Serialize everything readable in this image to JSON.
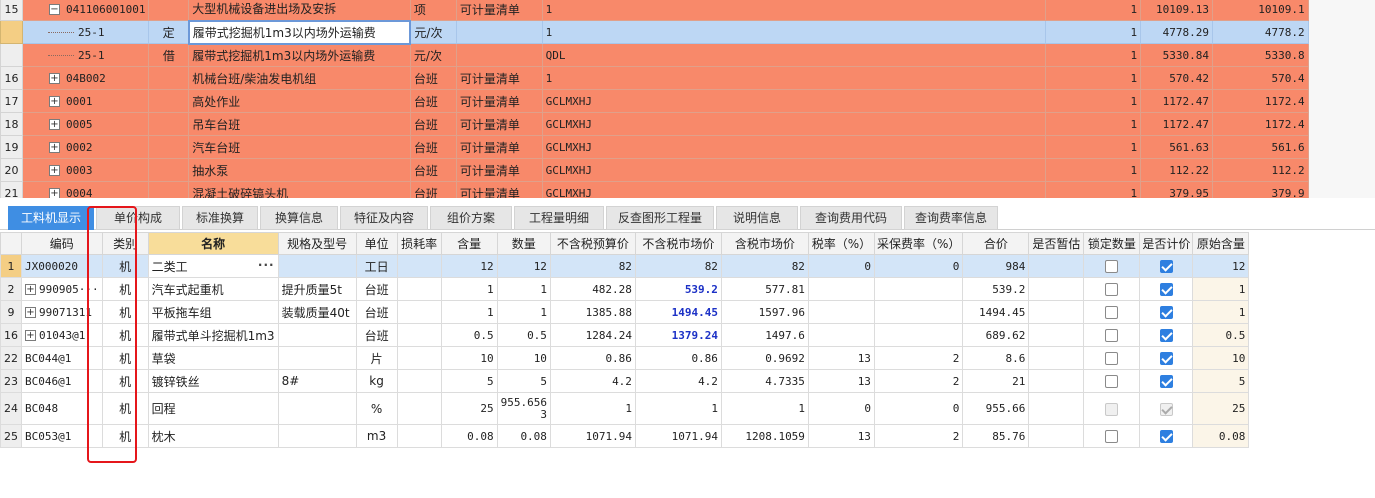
{
  "top_rows": [
    {
      "idx": "15",
      "code": "041106001001",
      "expander": "−",
      "type": "",
      "name": "大型机械设备进出场及安拆",
      "unit": "项",
      "qty_type": "可计量清单",
      "expr": "1",
      "qty": "1",
      "price": "10109.13",
      "total": "10109.1"
    },
    {
      "idx": "",
      "code": "25-1",
      "type": "定",
      "name": "履带式挖掘机1m3以内场外运输费",
      "unit": "元/次",
      "qty_type": "",
      "expr": "1",
      "qty": "1",
      "price": "4778.29",
      "total": "4778.2",
      "selected": true
    },
    {
      "idx": "",
      "code": "25-1",
      "type": "借",
      "name": "履带式挖掘机1m3以内场外运输费",
      "unit": "元/次",
      "qty_type": "",
      "expr": "QDL",
      "qty": "1",
      "price": "5330.84",
      "total": "5330.8"
    },
    {
      "idx": "16",
      "code": "04B002",
      "expander": "+",
      "type": "",
      "name": "机械台班/柴油发电机组",
      "unit": "台班",
      "qty_type": "可计量清单",
      "expr": "1",
      "qty": "1",
      "price": "570.42",
      "total": "570.4"
    },
    {
      "idx": "17",
      "code": "0001",
      "expander": "+",
      "type": "",
      "name": "高处作业",
      "unit": "台班",
      "qty_type": "可计量清单",
      "expr": "GCLMXHJ",
      "qty": "1",
      "price": "1172.47",
      "total": "1172.4"
    },
    {
      "idx": "18",
      "code": "0005",
      "expander": "+",
      "type": "",
      "name": "吊车台班",
      "unit": "台班",
      "qty_type": "可计量清单",
      "expr": "GCLMXHJ",
      "qty": "1",
      "price": "1172.47",
      "total": "1172.4"
    },
    {
      "idx": "19",
      "code": "0002",
      "expander": "+",
      "type": "",
      "name": "汽车台班",
      "unit": "台班",
      "qty_type": "可计量清单",
      "expr": "GCLMXHJ",
      "qty": "1",
      "price": "561.63",
      "total": "561.6"
    },
    {
      "idx": "20",
      "code": "0003",
      "expander": "+",
      "type": "",
      "name": "抽水泵",
      "unit": "台班",
      "qty_type": "可计量清单",
      "expr": "GCLMXHJ",
      "qty": "1",
      "price": "112.22",
      "total": "112.2"
    },
    {
      "idx": "21",
      "code": "0004",
      "expander": "+",
      "type": "",
      "name": "混凝土破碎镐头机",
      "unit": "台班",
      "qty_type": "可计量清单",
      "expr": "GCLMXHJ",
      "qty": "1",
      "price": "379.95",
      "total": "379.9"
    }
  ],
  "tabs": [
    {
      "label": "工料机显示",
      "active": true
    },
    {
      "label": "单价构成"
    },
    {
      "label": "标准换算"
    },
    {
      "label": "换算信息"
    },
    {
      "label": "特征及内容"
    },
    {
      "label": "组价方案"
    },
    {
      "label": "工程量明细"
    },
    {
      "label": "反查图形工程量"
    },
    {
      "label": "说明信息"
    },
    {
      "label": "查询费用代码"
    },
    {
      "label": "查询费率信息"
    }
  ],
  "columns": [
    "编码",
    "类别",
    "名称",
    "规格及型号",
    "单位",
    "损耗率",
    "含量",
    "数量",
    "不含税预算价",
    "不含税市场价",
    "含税市场价",
    "税率（%）",
    "采保费率（%）",
    "合价",
    "是否暂估",
    "锁定数量",
    "是否计价",
    "原始含量"
  ],
  "rows": [
    {
      "idx": "1",
      "code": "JX000020",
      "type": "机",
      "name": "二类工",
      "spec": "",
      "unit": "工日",
      "loss": "",
      "content": "12",
      "qty": "12",
      "pre_price": "82",
      "market": "82",
      "tax_market": "82",
      "tax_rate": "0",
      "fee_rate": "0",
      "total": "984",
      "lock": false,
      "price_on": true,
      "orig": "12",
      "selected": true,
      "dots": "···"
    },
    {
      "idx": "2",
      "expander": "+",
      "code": "990905···",
      "type": "机",
      "name": "汽车式起重机",
      "spec": "提升质量5t",
      "unit": "台班",
      "loss": "",
      "content": "1",
      "qty": "1",
      "pre_price": "482.28",
      "market": "539.2",
      "market_blue": true,
      "tax_market": "577.81",
      "tax_rate": "",
      "fee_rate": "",
      "total": "539.2",
      "lock": false,
      "price_on": true,
      "orig": "1"
    },
    {
      "idx": "9",
      "expander": "+",
      "code": "99071311",
      "type": "机",
      "name": "平板拖车组",
      "spec": "装载质量40t",
      "unit": "台班",
      "loss": "",
      "content": "1",
      "qty": "1",
      "pre_price": "1385.88",
      "market": "1494.45",
      "market_blue": true,
      "tax_market": "1597.96",
      "tax_rate": "",
      "fee_rate": "",
      "total": "1494.45",
      "lock": false,
      "price_on": true,
      "orig": "1"
    },
    {
      "idx": "16",
      "expander": "+",
      "code": "01043@1",
      "type": "机",
      "name": "履带式单斗挖掘机1m3",
      "spec": "",
      "unit": "台班",
      "loss": "",
      "content": "0.5",
      "qty": "0.5",
      "pre_price": "1284.24",
      "market": "1379.24",
      "market_blue": true,
      "tax_market": "1497.6",
      "tax_rate": "",
      "fee_rate": "",
      "total": "689.62",
      "lock": false,
      "price_on": true,
      "orig": "0.5"
    },
    {
      "idx": "22",
      "code": "BC044@1",
      "type": "机",
      "name": "草袋",
      "spec": "",
      "unit": "片",
      "loss": "",
      "content": "10",
      "qty": "10",
      "pre_price": "0.86",
      "market": "0.86",
      "tax_market": "0.9692",
      "tax_rate": "13",
      "fee_rate": "2",
      "total": "8.6",
      "lock": false,
      "price_on": true,
      "orig": "10"
    },
    {
      "idx": "23",
      "code": "BC046@1",
      "type": "机",
      "name": "镀锌铁丝",
      "spec": "8#",
      "unit": "kg",
      "loss": "",
      "content": "5",
      "qty": "5",
      "pre_price": "4.2",
      "market": "4.2",
      "tax_market": "4.7335",
      "tax_rate": "13",
      "fee_rate": "2",
      "total": "21",
      "lock": false,
      "price_on": true,
      "orig": "5"
    },
    {
      "idx": "24",
      "code": "BC048",
      "type": "机",
      "name": "回程",
      "spec": "",
      "unit": "%",
      "loss": "",
      "content": "25",
      "qty": "955.656\n3",
      "pre_price": "1",
      "market": "1",
      "tax_market": "1",
      "tax_rate": "0",
      "fee_rate": "0",
      "total": "955.66",
      "lock": false,
      "price_on": true,
      "disabled": true,
      "orig": "25",
      "tall": true
    },
    {
      "idx": "25",
      "code": "BC053@1",
      "type": "机",
      "name": "枕木",
      "spec": "",
      "unit": "m3",
      "loss": "",
      "content": "0.08",
      "qty": "0.08",
      "pre_price": "1071.94",
      "market": "1071.94",
      "tax_market": "1208.1059",
      "tax_rate": "13",
      "fee_rate": "2",
      "total": "85.76",
      "lock": false,
      "price_on": true,
      "orig": "0.08"
    }
  ],
  "colors": {
    "orange_row": "#f8896a",
    "selected_row": "#bdd7f4",
    "tab_active": "#3f8ee3",
    "highlight_box": "#e5161b",
    "blue_value": "#1c31c6"
  }
}
